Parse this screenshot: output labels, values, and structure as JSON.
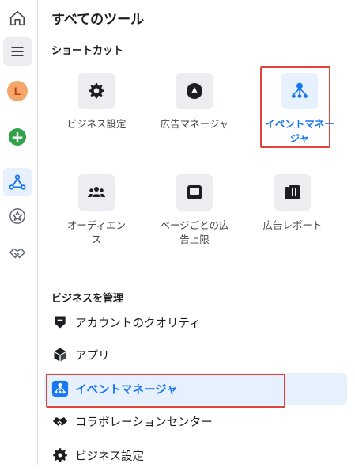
{
  "title": "すべてのツール",
  "shortcuts_heading": "ショートカット",
  "shortcuts": [
    {
      "label": "ビジネス設定",
      "icon": "gear-icon"
    },
    {
      "label": "広告マネージャ",
      "icon": "ads-manager-icon"
    },
    {
      "label": "イベントマネージャ",
      "icon": "events-manager-icon",
      "active": true
    },
    {
      "label": "オーディエンス",
      "icon": "audience-icon"
    },
    {
      "label": "ページごとの広告上限",
      "icon": "page-limit-icon"
    },
    {
      "label": "広告レポート",
      "icon": "ads-report-icon"
    }
  ],
  "manage_heading": "ビジネスを管理",
  "manage_items": [
    {
      "label": "アカウントのクオリティ",
      "icon": "shield-icon"
    },
    {
      "label": "アプリ",
      "icon": "cube-icon"
    },
    {
      "label": "イベントマネージャ",
      "icon": "events-manager-icon",
      "active": true
    },
    {
      "label": "コラボレーションセンター",
      "icon": "collab-icon"
    },
    {
      "label": "ビジネス設定",
      "icon": "gear-icon"
    }
  ],
  "sidebar": {
    "avatar_letter": "L",
    "items": [
      "home-icon",
      "menu-icon",
      "avatar",
      "create-icon",
      "events-manager-icon",
      "star-icon",
      "handshake-icon"
    ]
  },
  "colors": {
    "accent": "#1877f2",
    "highlight": "#e0443a",
    "active_bg": "#e7f0fd"
  }
}
